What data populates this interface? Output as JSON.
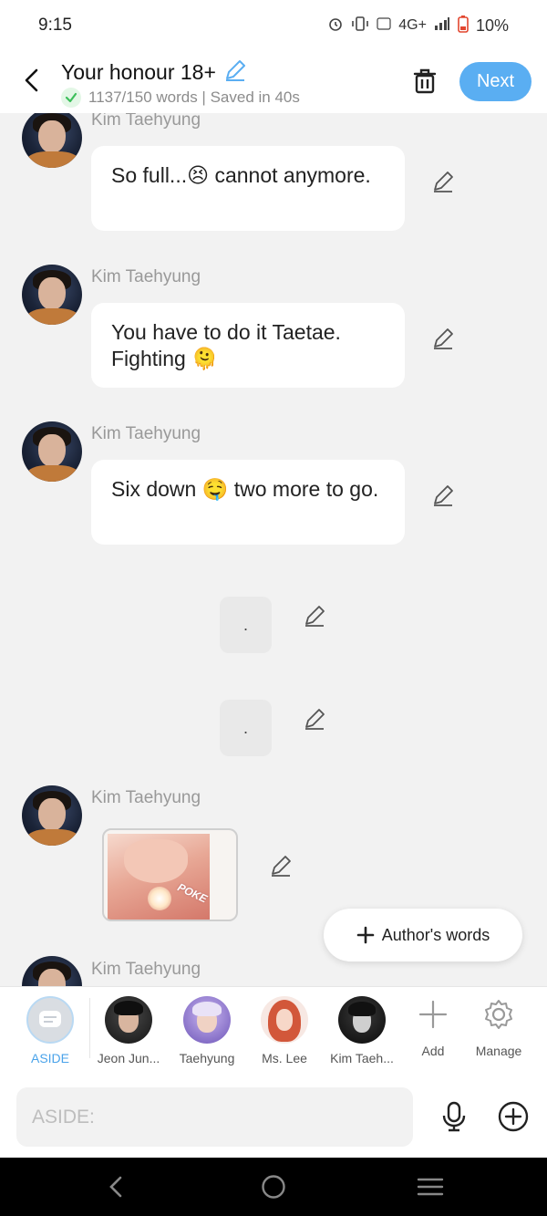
{
  "status_bar": {
    "time": "9:15",
    "network": "4G+",
    "battery": "10%"
  },
  "header": {
    "title": "Your honour 18+",
    "subtitle": "1137/150 words | Saved in 40s",
    "next_label": "Next"
  },
  "messages": [
    {
      "author": "Kim Taehyung",
      "text": "So full...😣 cannot anymore."
    },
    {
      "author": "Kim Taehyung",
      "text": "You have to do it Taetae. Fighting 🫠"
    },
    {
      "author": "Kim Taehyung",
      "text": "Six down 🤤 two more to go."
    },
    {
      "text": "."
    },
    {
      "text": "."
    },
    {
      "author": "Kim Taehyung",
      "image_caption": "POKE"
    },
    {
      "author": "Kim Taehyung"
    }
  ],
  "authors_words_label": "Author's words",
  "characters": [
    {
      "label": "ASIDE",
      "active": true,
      "icon": "aside-chat-icon"
    },
    {
      "label": "Jeon Jun..."
    },
    {
      "label": "Taehyung"
    },
    {
      "label": "Ms. Lee"
    },
    {
      "label": "Kim Taeh..."
    },
    {
      "label": "Add",
      "icon": "plus-icon"
    },
    {
      "label": "Manage",
      "icon": "gear-icon"
    }
  ],
  "input": {
    "placeholder": "ASIDE:"
  },
  "colors": {
    "accent": "#5aaef2",
    "background": "#f2f2f2"
  }
}
